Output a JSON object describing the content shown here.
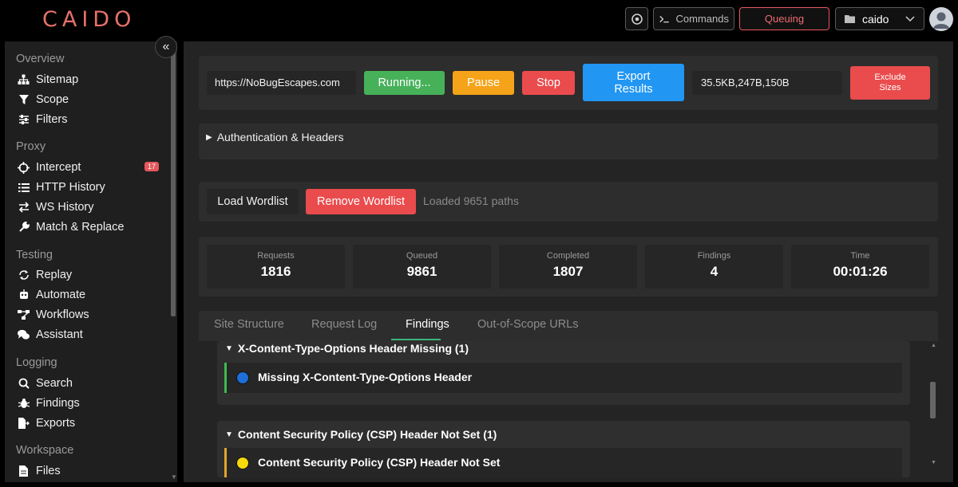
{
  "app": {
    "logo": "CAIDO"
  },
  "topbar": {
    "commands_label": "Commands",
    "queuing_label": "Queuing",
    "project_label": "caido",
    "icons": {
      "browser": "chrome-icon",
      "terminal": "terminal-icon",
      "folder": "folder-icon",
      "chevron": "chevron-down-icon",
      "avatar": "user-avatar-icon"
    }
  },
  "sidebar": {
    "collapse_icon": "double-chevron-left-icon",
    "sections": {
      "overview": {
        "label": "Overview",
        "items": [
          "Sitemap",
          "Scope",
          "Filters"
        ]
      },
      "proxy": {
        "label": "Proxy",
        "items": [
          "Intercept",
          "HTTP History",
          "WS History",
          "Match & Replace"
        ],
        "intercept_badge": "17"
      },
      "testing": {
        "label": "Testing",
        "items": [
          "Replay",
          "Automate",
          "Workflows",
          "Assistant"
        ]
      },
      "logging": {
        "label": "Logging",
        "items": [
          "Search",
          "Findings",
          "Exports"
        ]
      },
      "workspace": {
        "label": "Workspace",
        "items": [
          "Files"
        ]
      }
    }
  },
  "scanner": {
    "url": "https://NoBugEscapes.com",
    "running_label": "Running...",
    "pause_label": "Pause",
    "stop_label": "Stop",
    "export_label": "Export Results",
    "sizes_value": "35.5KB,247B,150B",
    "exclude_label": "Exclude Sizes",
    "auth_toggle_label": "Authentication & Headers",
    "load_wordlist_label": "Load Wordlist",
    "remove_wordlist_label": "Remove Wordlist",
    "loaded_text": "Loaded 9651 paths",
    "colors": {
      "running": "#47b15a",
      "pause": "#f5a318",
      "stop": "#ea4b4d",
      "export": "#2196f3",
      "exclude": "#ea4b4d",
      "remove": "#ea4b4d"
    }
  },
  "stats": [
    {
      "label": "Requests",
      "value": "1816"
    },
    {
      "label": "Queued",
      "value": "9861"
    },
    {
      "label": "Completed",
      "value": "1807"
    },
    {
      "label": "Findings",
      "value": "4"
    },
    {
      "label": "Time",
      "value": "00:01:26"
    }
  ],
  "tabs": [
    "Site Structure",
    "Request Log",
    "Findings",
    "Out-of-Scope URLs"
  ],
  "active_tab": "Findings",
  "findings": [
    {
      "group": "X-Content-Type-Options Header Missing (1)",
      "item": "Missing X-Content-Type-Options Header",
      "severity_color": "#1e6fd9",
      "stripe_color": "#3fb950"
    },
    {
      "group": "Content Security Policy (CSP) Header Not Set (1)",
      "item": "Content Security Policy (CSP) Header Not Set",
      "severity_color": "#f5d90a",
      "stripe_color": "#e3a52b"
    }
  ]
}
